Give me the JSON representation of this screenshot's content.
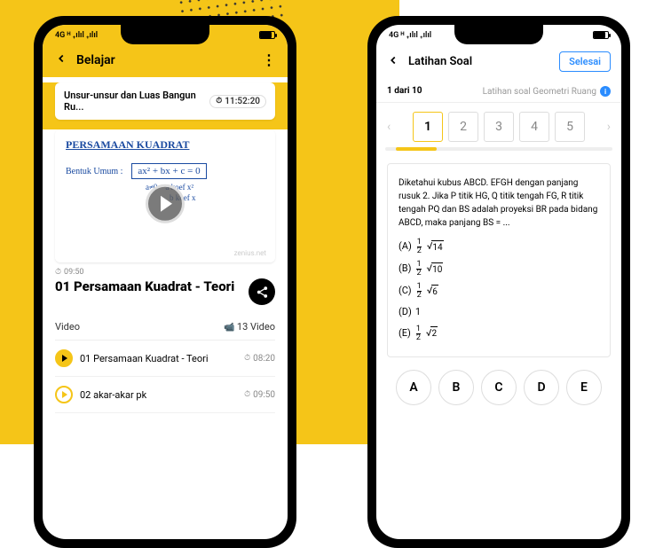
{
  "left": {
    "status": {
      "signal": "4G ᴴ ₊ılıl  ₊ılıl"
    },
    "header": {
      "title": "Belajar"
    },
    "chip": {
      "title": "Unsur-unsur dan Luas Bangun Ru...",
      "time": "11:52:20"
    },
    "video": {
      "hand_title": "PERSAMAAN KUADRAT",
      "hand_sub": "Bentuk Umum :",
      "hand_eq": "ax² + bx + c = 0",
      "hand_notes": "a≠0    a koef x²\n            b koef x",
      "watermark": "zenius.net",
      "time": "09:50",
      "title": "01 Persamaan Kuadrat - Teori"
    },
    "list": {
      "heading": "Video",
      "count": "13 Video",
      "items": [
        {
          "title": "01 Persamaan Kuadrat - Teori",
          "time": "08:20",
          "active": true
        },
        {
          "title": "02 akar-akar pk",
          "time": "09:50",
          "active": false
        }
      ]
    }
  },
  "right": {
    "header": {
      "title": "Latihan Soal",
      "done": "Selesai"
    },
    "subheader": {
      "progress": "1 dari 10",
      "label": "Latihan soal Geometri Ruang"
    },
    "pager": {
      "pages": [
        "1",
        "2",
        "3",
        "4",
        "5"
      ],
      "active": 0
    },
    "question": {
      "text": "Diketahui kubus ABCD. EFGH dengan panjang rusuk 2. Jika P titik HG, Q titik tengah FG, R titik tengah PQ dan BS adalah proyeksi BR pada bidang ABCD, maka panjang BS = ...",
      "options": [
        {
          "label": "(A)",
          "frac": true,
          "rad": "14"
        },
        {
          "label": "(B)",
          "frac": true,
          "rad": "10"
        },
        {
          "label": "(C)",
          "frac": true,
          "rad": "6"
        },
        {
          "label": "(D)",
          "plain": "1"
        },
        {
          "label": "(E)",
          "frac": true,
          "rad": "2"
        }
      ]
    },
    "answers": [
      "A",
      "B",
      "C",
      "D",
      "E"
    ]
  }
}
